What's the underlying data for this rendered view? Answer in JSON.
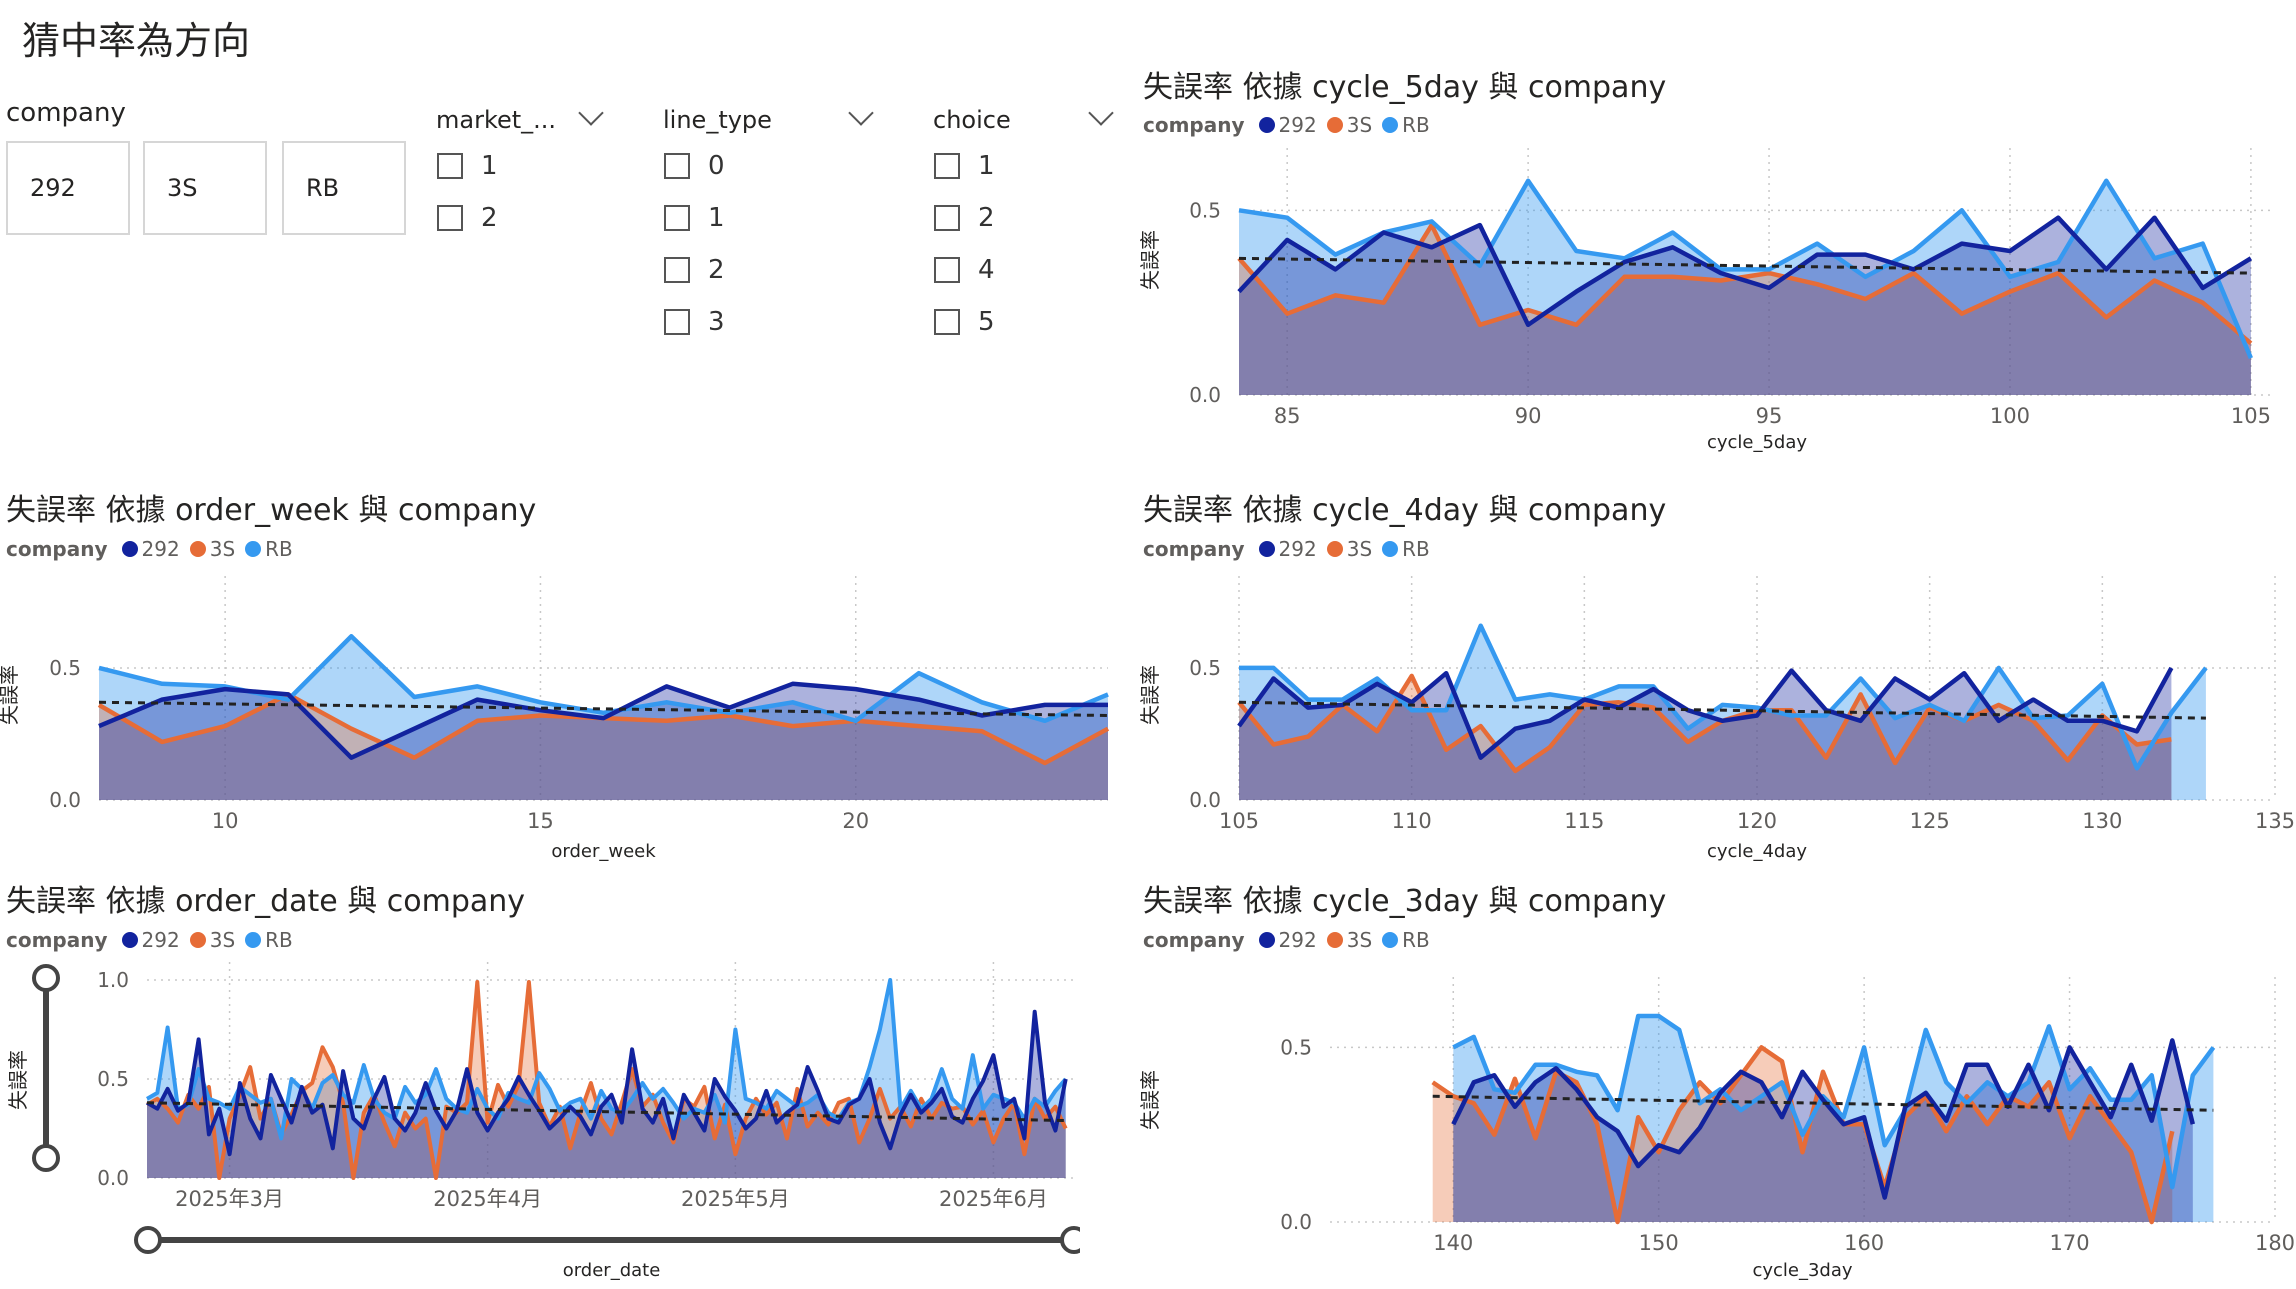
{
  "page": {
    "title": "猜中率為方向"
  },
  "colors": {
    "s292": "#12239e",
    "s3S": "#e66c37",
    "sRB": "#3599f0",
    "trend": "#222222",
    "grid": "#c8c8c8",
    "axis_text": "#605e5c"
  },
  "slicers": {
    "company": {
      "title": "company",
      "tiles": [
        "292",
        "3S",
        "RB"
      ]
    },
    "market": {
      "title": "market_...",
      "options": [
        "1",
        "2"
      ]
    },
    "line_type": {
      "title": "line_type",
      "options": [
        "0",
        "1",
        "2",
        "3"
      ]
    },
    "choice": {
      "title": "choice",
      "options": [
        "1",
        "2",
        "4",
        "5"
      ]
    }
  },
  "legend": {
    "title": "company",
    "items": [
      "292",
      "3S",
      "RB"
    ]
  },
  "date_slider": {
    "start_label": "",
    "end_label": ""
  },
  "chart_data": [
    {
      "id": "cycle5",
      "type": "area",
      "title": "失誤率 依據 cycle_5day 與 company",
      "xlabel": "cycle_5day",
      "ylabel": "失誤率",
      "xlim": [
        84,
        105.5
      ],
      "ylim": [
        0,
        0.62
      ],
      "xticks": [
        85,
        90,
        95,
        100,
        105
      ],
      "yticks": [
        0,
        0.5
      ],
      "ytick_labels": [
        "0.0",
        "0.5"
      ],
      "x": [
        84,
        85,
        86,
        87,
        88,
        89,
        90,
        91,
        92,
        93,
        94,
        95,
        96,
        97,
        98,
        99,
        100,
        101,
        102,
        103,
        104,
        105
      ],
      "series": [
        {
          "name": "292",
          "values": [
            0.28,
            0.42,
            0.34,
            0.44,
            0.4,
            0.46,
            0.19,
            0.28,
            0.36,
            0.4,
            0.33,
            0.29,
            0.38,
            0.38,
            0.34,
            0.41,
            0.39,
            0.48,
            0.34,
            0.48,
            0.29,
            0.37
          ]
        },
        {
          "name": "3S",
          "values": [
            0.37,
            0.22,
            0.27,
            0.25,
            0.46,
            0.19,
            0.23,
            0.19,
            0.32,
            0.32,
            0.31,
            0.33,
            0.3,
            0.26,
            0.33,
            0.22,
            0.28,
            0.33,
            0.21,
            0.31,
            0.25,
            0.14
          ]
        },
        {
          "name": "RB",
          "values": [
            0.5,
            0.48,
            0.38,
            0.44,
            0.47,
            0.35,
            0.58,
            0.39,
            0.37,
            0.44,
            0.34,
            0.34,
            0.41,
            0.32,
            0.39,
            0.5,
            0.32,
            0.36,
            0.58,
            0.37,
            0.41,
            0.1
          ]
        }
      ],
      "trend": [
        0.37,
        0.33
      ]
    },
    {
      "id": "week",
      "type": "area",
      "title": "失誤率 依據 order_week 與 company",
      "xlabel": "order_week",
      "ylabel": "失誤率",
      "xlim": [
        8,
        24
      ],
      "ylim": [
        0,
        0.78
      ],
      "xticks": [
        10,
        15,
        20
      ],
      "yticks": [
        0,
        0.5
      ],
      "ytick_labels": [
        "0.0",
        "0.5"
      ],
      "x": [
        8,
        9,
        10,
        11,
        12,
        13,
        14,
        15,
        16,
        17,
        18,
        19,
        20,
        21,
        22,
        23,
        24
      ],
      "series": [
        {
          "name": "292",
          "values": [
            0.28,
            0.38,
            0.42,
            0.4,
            0.16,
            0.27,
            0.38,
            0.34,
            0.31,
            0.43,
            0.35,
            0.44,
            0.42,
            0.38,
            0.32,
            0.36,
            0.36
          ]
        },
        {
          "name": "3S",
          "values": [
            0.36,
            0.22,
            0.28,
            0.4,
            0.27,
            0.16,
            0.3,
            0.32,
            0.31,
            0.3,
            0.32,
            0.28,
            0.3,
            0.28,
            0.26,
            0.14,
            0.27
          ]
        },
        {
          "name": "RB",
          "values": [
            0.5,
            0.44,
            0.43,
            0.38,
            0.62,
            0.39,
            0.43,
            0.37,
            0.33,
            0.37,
            0.33,
            0.37,
            0.3,
            0.48,
            0.37,
            0.3,
            0.4
          ]
        }
      ],
      "trend": [
        0.37,
        0.32
      ]
    },
    {
      "id": "cycle4",
      "type": "area",
      "title": "失誤率 依據 cycle_4day 與 company",
      "xlabel": "cycle_4day",
      "ylabel": "失誤率",
      "xlim": [
        105,
        135
      ],
      "ylim": [
        0,
        0.78
      ],
      "xticks": [
        105,
        110,
        115,
        120,
        125,
        130,
        135
      ],
      "yticks": [
        0,
        0.5
      ],
      "ytick_labels": [
        "0.0",
        "0.5"
      ],
      "x": [
        105,
        106,
        107,
        108,
        109,
        110,
        111,
        112,
        113,
        114,
        115,
        116,
        117,
        118,
        119,
        120,
        121,
        122,
        123,
        124,
        125,
        126,
        127,
        128,
        129,
        130,
        131,
        132,
        133
      ],
      "series": [
        {
          "name": "292",
          "values": [
            0.28,
            0.46,
            0.35,
            0.36,
            0.44,
            0.37,
            0.48,
            0.16,
            0.27,
            0.3,
            0.38,
            0.35,
            0.42,
            0.34,
            0.3,
            0.32,
            0.49,
            0.34,
            0.3,
            0.46,
            0.38,
            0.48,
            0.3,
            0.38,
            0.3,
            0.3,
            0.26,
            0.5,
            null
          ]
        },
        {
          "name": "3S",
          "values": [
            0.37,
            0.21,
            0.24,
            0.36,
            0.26,
            0.47,
            0.19,
            0.28,
            0.11,
            0.2,
            0.36,
            0.37,
            0.35,
            0.22,
            0.3,
            0.34,
            0.34,
            0.16,
            0.4,
            0.14,
            0.35,
            0.3,
            0.36,
            0.3,
            0.15,
            0.32,
            0.21,
            0.23,
            null
          ]
        },
        {
          "name": "RB",
          "values": [
            0.5,
            0.5,
            0.38,
            0.38,
            0.46,
            0.34,
            0.34,
            0.66,
            0.38,
            0.4,
            0.38,
            0.43,
            0.43,
            0.27,
            0.36,
            0.35,
            0.32,
            0.32,
            0.46,
            0.31,
            0.36,
            0.3,
            0.5,
            0.31,
            0.32,
            0.44,
            0.12,
            0.33,
            0.5
          ]
        }
      ],
      "trend": [
        0.37,
        0.31
      ]
    },
    {
      "id": "date",
      "type": "area",
      "title": "失誤率 依據 order_date 與 company",
      "xlabel": "order_date",
      "ylabel": "失誤率",
      "xlim": [
        0,
        90
      ],
      "ylim": [
        0,
        1.0
      ],
      "xticks": [
        8,
        33,
        57,
        82
      ],
      "xtick_labels": [
        "2025年3月",
        "2025年4月",
        "2025年5月",
        "2025年6月"
      ],
      "yticks": [
        0,
        0.5,
        1.0
      ],
      "ytick_labels": [
        "0.0",
        "0.5",
        "1.0"
      ],
      "x": [
        0,
        1,
        2,
        3,
        4,
        5,
        6,
        7,
        8,
        9,
        10,
        11,
        12,
        13,
        14,
        15,
        16,
        17,
        18,
        19,
        20,
        21,
        22,
        23,
        24,
        25,
        26,
        27,
        28,
        29,
        30,
        31,
        32,
        33,
        34,
        35,
        36,
        37,
        38,
        39,
        40,
        41,
        42,
        43,
        44,
        45,
        46,
        47,
        48,
        49,
        50,
        51,
        52,
        53,
        54,
        55,
        56,
        57,
        58,
        59,
        60,
        61,
        62,
        63,
        64,
        65,
        66,
        67,
        68,
        69,
        70,
        71,
        72,
        73,
        74,
        75,
        76,
        77,
        78,
        79,
        80,
        81,
        82,
        83,
        84,
        85,
        86,
        87,
        88,
        89
      ],
      "series": [
        {
          "name": "292",
          "values": [
            0.38,
            0.35,
            0.45,
            0.34,
            0.38,
            0.7,
            0.22,
            0.35,
            0.12,
            0.48,
            0.3,
            0.2,
            0.52,
            0.4,
            0.28,
            0.46,
            0.33,
            0.37,
            0.15,
            0.54,
            0.3,
            0.25,
            0.4,
            0.51,
            0.3,
            0.24,
            0.33,
            0.48,
            0.34,
            0.25,
            0.34,
            0.55,
            0.33,
            0.24,
            0.33,
            0.4,
            0.51,
            0.42,
            0.34,
            0.25,
            0.3,
            0.36,
            0.31,
            0.22,
            0.36,
            0.42,
            0.28,
            0.65,
            0.35,
            0.28,
            0.4,
            0.2,
            0.42,
            0.33,
            0.24,
            0.5,
            0.41,
            0.34,
            0.25,
            0.3,
            0.44,
            0.28,
            0.33,
            0.37,
            0.56,
            0.44,
            0.3,
            0.28,
            0.37,
            0.4,
            0.5,
            0.28,
            0.15,
            0.32,
            0.42,
            0.33,
            0.38,
            0.45,
            0.31,
            0.28,
            0.4,
            0.49,
            0.62,
            0.36,
            0.4,
            0.2,
            0.84,
            0.38,
            0.24,
            0.5
          ]
        },
        {
          "name": "3S",
          "values": [
            0.37,
            0.4,
            0.35,
            0.28,
            0.42,
            0.35,
            0.46,
            0.0,
            0.3,
            0.42,
            0.56,
            0.3,
            0.4,
            0.22,
            0.32,
            0.44,
            0.48,
            0.66,
            0.56,
            0.38,
            0.0,
            0.33,
            0.42,
            0.28,
            0.16,
            0.33,
            0.25,
            0.3,
            0.0,
            0.36,
            0.33,
            0.38,
            0.99,
            0.28,
            0.47,
            0.36,
            0.47,
            0.99,
            0.38,
            0.26,
            0.36,
            0.15,
            0.33,
            0.48,
            0.3,
            0.22,
            0.38,
            0.55,
            0.36,
            0.42,
            0.28,
            0.18,
            0.4,
            0.36,
            0.46,
            0.2,
            0.37,
            0.12,
            0.3,
            0.4,
            0.32,
            0.38,
            0.2,
            0.45,
            0.26,
            0.33,
            0.27,
            0.38,
            0.4,
            0.18,
            0.3,
            0.45,
            0.3,
            0.36,
            0.26,
            0.4,
            0.3,
            0.38,
            0.35,
            0.36,
            0.27,
            0.34,
            0.18,
            0.3,
            0.38,
            0.12,
            0.4,
            0.3,
            0.36,
            0.25
          ]
        },
        {
          "name": "RB",
          "values": [
            0.4,
            0.43,
            0.76,
            0.35,
            0.37,
            0.55,
            0.4,
            0.38,
            0.35,
            0.46,
            0.42,
            0.38,
            0.4,
            0.2,
            0.5,
            0.45,
            0.35,
            0.48,
            0.52,
            0.42,
            0.38,
            0.57,
            0.4,
            0.33,
            0.3,
            0.46,
            0.38,
            0.42,
            0.55,
            0.4,
            0.35,
            0.33,
            0.45,
            0.35,
            0.3,
            0.43,
            0.4,
            0.38,
            0.53,
            0.45,
            0.34,
            0.38,
            0.4,
            0.3,
            0.44,
            0.35,
            0.33,
            0.4,
            0.48,
            0.4,
            0.45,
            0.38,
            0.3,
            0.35,
            0.33,
            0.42,
            0.28,
            0.75,
            0.4,
            0.38,
            0.35,
            0.44,
            0.4,
            0.36,
            0.38,
            0.42,
            0.33,
            0.3,
            0.38,
            0.4,
            0.56,
            0.75,
            1.0,
            0.35,
            0.44,
            0.35,
            0.4,
            0.55,
            0.4,
            0.35,
            0.62,
            0.35,
            0.42,
            0.4,
            0.38,
            0.3,
            0.4,
            0.36,
            0.44,
            0.5
          ]
        }
      ],
      "trend": [
        0.38,
        0.29
      ]
    },
    {
      "id": "cycle3",
      "type": "area",
      "title": "失誤率 依據 cycle_3day 與 company",
      "xlabel": "cycle_3day",
      "ylabel": "失誤率",
      "xlim": [
        134,
        180
      ],
      "ylim": [
        0,
        0.65
      ],
      "xticks": [
        140,
        150,
        160,
        170,
        180
      ],
      "yticks": [
        0,
        0.5
      ],
      "ytick_labels": [
        "0.0",
        "0.5"
      ],
      "x": [
        139,
        140,
        141,
        142,
        143,
        144,
        145,
        146,
        147,
        148,
        149,
        150,
        151,
        152,
        153,
        154,
        155,
        156,
        157,
        158,
        159,
        160,
        161,
        162,
        163,
        164,
        165,
        166,
        167,
        168,
        169,
        170,
        171,
        172,
        173,
        174,
        175,
        176,
        177
      ],
      "series": [
        {
          "name": "292",
          "values": [
            null,
            0.28,
            0.4,
            0.42,
            0.33,
            0.4,
            0.44,
            0.38,
            0.3,
            0.26,
            0.16,
            0.22,
            0.2,
            0.27,
            0.37,
            0.43,
            0.4,
            0.3,
            0.43,
            0.35,
            0.28,
            0.3,
            0.07,
            0.33,
            0.37,
            0.29,
            0.45,
            0.45,
            0.33,
            0.45,
            0.32,
            0.5,
            0.4,
            0.3,
            0.45,
            0.29,
            0.52,
            0.28,
            null
          ]
        },
        {
          "name": "3S",
          "values": [
            0.4,
            0.36,
            0.34,
            0.25,
            0.41,
            0.24,
            0.43,
            0.4,
            0.28,
            0.0,
            0.3,
            0.2,
            0.32,
            0.4,
            0.34,
            0.42,
            0.5,
            0.46,
            0.2,
            0.43,
            0.28,
            0.28,
            0.1,
            0.3,
            0.36,
            0.26,
            0.36,
            0.28,
            0.36,
            0.33,
            0.4,
            0.24,
            0.36,
            0.28,
            0.2,
            0.0,
            0.26,
            null,
            null
          ]
        },
        {
          "name": "RB",
          "values": [
            null,
            0.5,
            0.53,
            0.38,
            0.37,
            0.45,
            0.45,
            0.43,
            0.42,
            0.32,
            0.59,
            0.59,
            0.55,
            0.34,
            0.38,
            0.32,
            0.36,
            0.4,
            0.25,
            0.36,
            0.3,
            0.5,
            0.22,
            0.32,
            0.55,
            0.4,
            0.34,
            0.4,
            0.36,
            0.4,
            0.56,
            0.38,
            0.44,
            0.35,
            0.35,
            0.42,
            0.1,
            0.42,
            0.5
          ]
        }
      ],
      "trend": [
        0.36,
        0.32
      ]
    }
  ]
}
